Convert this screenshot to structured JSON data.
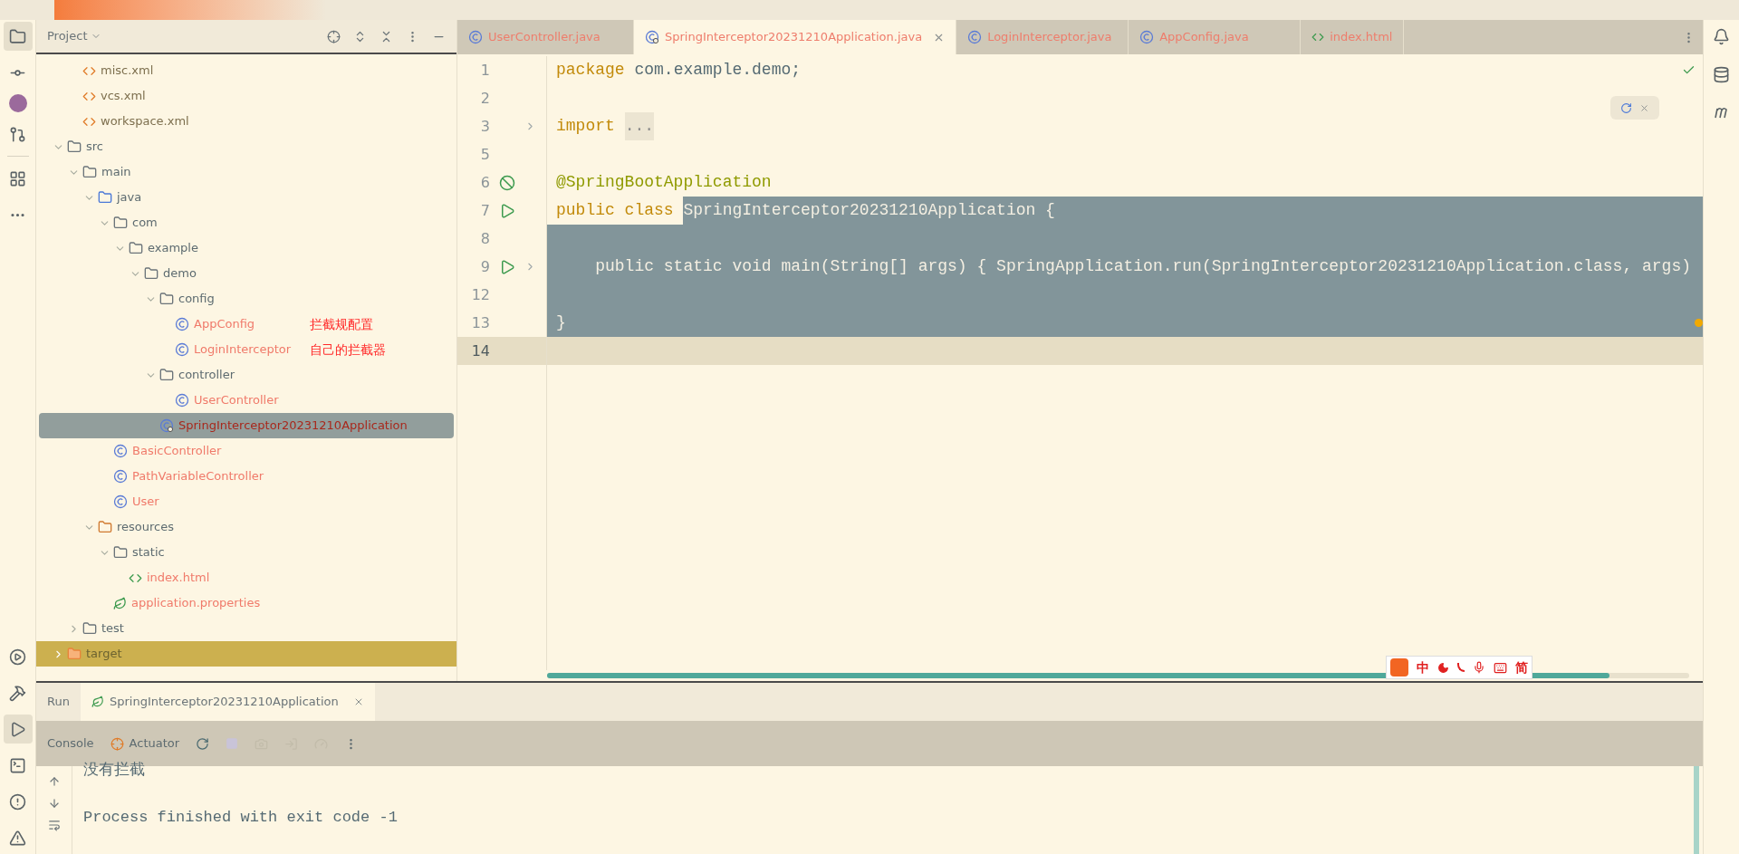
{
  "project_panel": {
    "title": "Project"
  },
  "tree": {
    "scrolled_children": [
      {
        "name": "misc.xml",
        "kind": "xml",
        "selected": false,
        "color": "#7d6f4e"
      },
      {
        "name": "vcs.xml",
        "kind": "xml",
        "selected": false,
        "color": "#7d6f4e"
      },
      {
        "name": "workspace.xml",
        "kind": "xml",
        "selected": false,
        "color": "#7d6f4e"
      }
    ],
    "items": [
      {
        "name": "src",
        "kind": "folder",
        "selected": false,
        "expanded": true,
        "excluded": false,
        "children": [
          {
            "name": "main",
            "kind": "folder",
            "selected": false,
            "expanded": true,
            "children": [
              {
                "name": "java",
                "kind": "source",
                "selected": false,
                "expanded": true,
                "children": [
                  {
                    "name": "com",
                    "kind": "package",
                    "selected": false,
                    "expanded": true,
                    "children": [
                      {
                        "name": "example",
                        "kind": "package",
                        "selected": false,
                        "expanded": true,
                        "children": [
                          {
                            "name": "demo",
                            "kind": "package",
                            "selected": false,
                            "expanded": true,
                            "children": [
                              {
                                "name": "config",
                                "kind": "package",
                                "selected": false,
                                "expanded": true,
                                "children": [
                                  {
                                    "name": "AppConfig",
                                    "kind": "class",
                                    "selected": false,
                                    "color": "#f07a6a",
                                    "note": "拦截规配置"
                                  },
                                  {
                                    "name": "LoginInterceptor",
                                    "kind": "class",
                                    "selected": false,
                                    "color": "#f07a6a",
                                    "note": "自己的拦截器"
                                  }
                                ]
                              },
                              {
                                "name": "controller",
                                "kind": "package",
                                "selected": false,
                                "expanded": true,
                                "children": [
                                  {
                                    "name": "UserController",
                                    "kind": "class",
                                    "selected": false,
                                    "color": "#f07a6a"
                                  }
                                ]
                              },
                              {
                                "name": "SpringInterceptor20231210Application",
                                "kind": "boot",
                                "selected": true,
                                "color": "#a8281c"
                              }
                            ]
                          }
                        ]
                      }
                    ]
                  },
                  {
                    "name": "BasicController",
                    "kind": "class",
                    "selected": false,
                    "color": "#f07a6a"
                  },
                  {
                    "name": "PathVariableController",
                    "kind": "class",
                    "selected": false,
                    "color": "#f07a6a"
                  },
                  {
                    "name": "User",
                    "kind": "class",
                    "selected": false,
                    "color": "#f07a6a"
                  }
                ]
              },
              {
                "name": "resources",
                "kind": "resources",
                "selected": false,
                "expanded": true,
                "children": [
                  {
                    "name": "static",
                    "kind": "folder",
                    "selected": false,
                    "expanded": true,
                    "children": [
                      {
                        "name": "index.html",
                        "kind": "html",
                        "selected": false,
                        "color": "#f07a6a"
                      }
                    ]
                  },
                  {
                    "name": "application.properties",
                    "kind": "properties",
                    "selected": false,
                    "color": "#f07a6a"
                  }
                ]
              }
            ]
          },
          {
            "name": "test",
            "kind": "folder",
            "selected": false,
            "expanded": false
          }
        ]
      },
      {
        "name": "target",
        "kind": "excluded_folder",
        "selected": false,
        "expanded": false,
        "excluded": true
      }
    ]
  },
  "editor_tabs": [
    {
      "label": "UserController.java",
      "kind": "class",
      "selected": false
    },
    {
      "label": "SpringInterceptor20231210Application.java",
      "kind": "boot",
      "selected": true
    },
    {
      "label": "LoginInterceptor.java",
      "kind": "class",
      "selected": false
    },
    {
      "label": "AppConfig.java",
      "kind": "class",
      "selected": false
    },
    {
      "label": "index.html",
      "kind": "html",
      "selected": false
    }
  ],
  "editor": {
    "lines": [
      {
        "number": "1",
        "selected": false,
        "current": false,
        "tokens": [
          {
            "text": "package",
            "kind": "keyword",
            "selected": false
          },
          {
            "text": " com.example.demo;",
            "kind": "plain",
            "selected": false
          }
        ]
      },
      {
        "number": "2",
        "selected": false,
        "current": false
      },
      {
        "number": "3",
        "selected": false,
        "current": false,
        "fold": true,
        "tokens": [
          {
            "text": "import ",
            "kind": "keyword",
            "selected": false
          },
          {
            "text": "...",
            "kind": "folded",
            "selected": false
          }
        ]
      },
      {
        "number": "5",
        "selected": false,
        "current": false
      },
      {
        "number": "6",
        "selected": false,
        "current": false,
        "gutter": {
          "kind": "bean"
        },
        "tokens": [
          {
            "text": "@SpringBootApplication",
            "kind": "annotation",
            "selected": false
          }
        ]
      },
      {
        "number": "7",
        "selected": false,
        "current": false,
        "gutter": {
          "kind": "run"
        },
        "tokens": [
          {
            "text": "public class ",
            "kind": "keyword",
            "selected": false
          },
          {
            "text": "SpringInterceptor20231210Application {",
            "kind": "plain",
            "selected": true
          }
        ]
      },
      {
        "number": "8",
        "selected": true,
        "current": false
      },
      {
        "number": "9",
        "selected": true,
        "current": false,
        "gutter": {
          "kind": "run"
        },
        "fold": true,
        "tokens": [
          {
            "text": "    public static void main(String[] args) { SpringApplication.run(SpringInterceptor20231210Application.class, args)",
            "kind": "plain",
            "selected": true
          }
        ]
      },
      {
        "number": "12",
        "selected": true,
        "current": false
      },
      {
        "number": "13",
        "selected": true,
        "current": false,
        "bulb": true,
        "tokens": [
          {
            "text": "}",
            "kind": "plain",
            "selected": true
          }
        ]
      },
      {
        "number": "14",
        "selected": false,
        "current": true
      }
    ]
  },
  "ime_bar": {
    "items": [
      {
        "text": "中"
      },
      {
        "text": "简"
      }
    ]
  },
  "run_panel": {
    "title": "Run",
    "tab": {
      "label": "SpringInterceptor20231210Application",
      "selected": true
    },
    "toolbar": [
      {
        "label": "Console",
        "selected": false
      },
      {
        "label": "Actuator",
        "selected": false
      }
    ],
    "console": [
      "没有拦截",
      "Process finished with exit code -1"
    ]
  }
}
